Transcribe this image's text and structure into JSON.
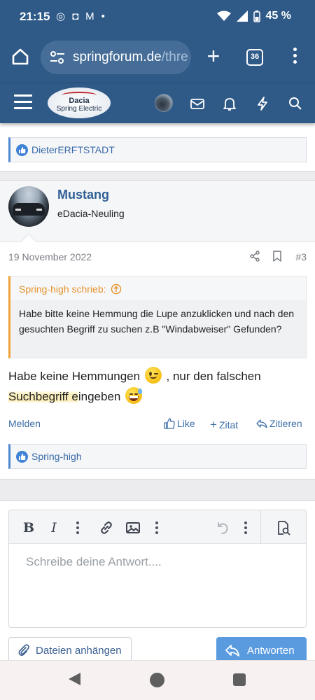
{
  "status_bar": {
    "time": "21:15",
    "battery": "45 %"
  },
  "browser": {
    "url_host": "springforum.de",
    "url_path": "/thre",
    "tab_count": "36"
  },
  "forum_header": {
    "logo_brand": "Dacia",
    "logo_sub": "Spring Electric"
  },
  "prev_post": {
    "reaction_user": "DieterERFTSTADT"
  },
  "post": {
    "author": "Mustang",
    "author_title": "eDacia-Neuling",
    "date": "19 November 2022",
    "number": "#3",
    "quote_author": "Spring-high schrieb:",
    "quote_text": "Habe bitte keine Hemmung die Lupe anzuklicken und nach den gesuchten Begriff zu suchen z.B \"Windabweiser\" Gefunden?",
    "text_part1": "Habe keine Hemmungen",
    "text_part2": ", nur den falschen",
    "text_part3": "Suchbegriff e",
    "text_part4": "ingeben",
    "actions": {
      "report": "Melden",
      "like": "Like",
      "quote": "Zitat",
      "reply_quote": "Zitieren"
    },
    "reaction_user": "Spring-high"
  },
  "editor": {
    "placeholder": "Schreibe deine Antwort....",
    "bold": "B",
    "italic": "I"
  },
  "buttons": {
    "attach": "Dateien anhängen",
    "reply": "Antworten"
  },
  "colors": {
    "header_blue": "#2f5a88",
    "link_blue": "#3d6fa8",
    "quote_orange": "#e4932b",
    "reply_button": "#5a9be0"
  }
}
